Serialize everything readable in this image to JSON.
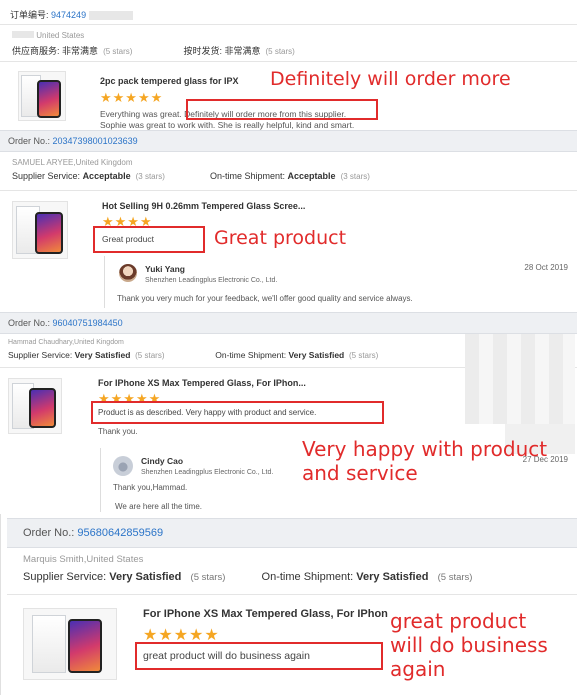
{
  "colors": {
    "accent": "#2b74c8",
    "stars": "#f5a623",
    "annotation": "#e12b2b"
  },
  "blocks": [
    {
      "order_label": "订单编号:",
      "order_no": "9474249",
      "buyer": "United States",
      "supplier_service_label": "供应商服务:",
      "supplier_service_value": "非常满意",
      "supplier_stars": "(5 stars)",
      "shipment_label": "按时发货:",
      "shipment_value": "非常满意",
      "shipment_stars": "(5 stars)",
      "product_title": "2pc pack tempered glass for IPX",
      "stars": "★★★★★",
      "review_line1": "Everything was great. Definitely will order more from this supplier.",
      "review_line2": "Sophie was great to work with. She is really helpful, kind and smart.",
      "annotation": "Definitely will order more"
    },
    {
      "order_label": "Order No.:",
      "order_no": "20347398001023639",
      "buyer": "SAMUEL ARYEE,United Kingdom",
      "supplier_service_label": "Supplier Service:",
      "supplier_service_value": "Acceptable",
      "supplier_stars": "(3 stars)",
      "shipment_label": "On-time Shipment:",
      "shipment_value": "Acceptable",
      "shipment_stars": "(3 stars)",
      "product_title": "Hot Selling 9H 0.26mm Tempered Glass Scree...",
      "stars": "★★★★",
      "review": "Great product",
      "annotation": "Great product",
      "reply": {
        "name": "Yuki Yang",
        "company": "Shenzhen Leadingplus Electronic Co., Ltd.",
        "date": "28 Oct 2019",
        "text": "Thank you very much for your feedback, we'll offer good quality and service always."
      }
    },
    {
      "order_label": "Order No.:",
      "order_no": "96040751984450",
      "buyer": "Hammad Chaudhary,United Kingdom",
      "supplier_service_label": "Supplier Service:",
      "supplier_service_value": "Very Satisfied",
      "supplier_stars": "(5 stars)",
      "shipment_label": "On-time Shipment:",
      "shipment_value": "Very Satisfied",
      "shipment_stars": "(5 stars)",
      "product_title": "For IPhone XS Max Tempered Glass, For IPhon...",
      "stars": "★★★★★",
      "review": "Product is as described. Very happy with product and service.",
      "review_extra": "Thank you.",
      "annotation_line1": "Very happy with product",
      "annotation_line2": "and service",
      "reply": {
        "name": "Cindy Cao",
        "company": "Shenzhen Leadingplus Electronic Co., Ltd.",
        "date": "27 Dec 2019",
        "line1": "Thank you,Hammad.",
        "line2": "We are here all the time."
      }
    },
    {
      "order_label": "Order No.:",
      "order_no": "95680642859569",
      "buyer": "Marquis Smith,United States",
      "supplier_service_label": "Supplier Service:",
      "supplier_service_value": "Very Satisfied",
      "supplier_stars": "(5 stars)",
      "shipment_label": "On-time Shipment:",
      "shipment_value": "Very Satisfied",
      "shipment_stars": "(5 stars)",
      "product_title": "For IPhone XS Max Tempered Glass, For IPhon",
      "stars": "★★★★★",
      "review": "great product will do business again",
      "annotation_line1": "great product",
      "annotation_line2": "will do business",
      "annotation_line3": "again"
    }
  ]
}
